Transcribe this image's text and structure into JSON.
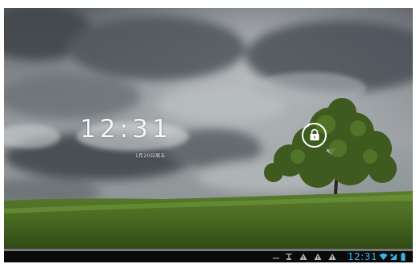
{
  "lockscreen": {
    "time": "12:31",
    "date": "1月20日周五"
  },
  "status_bar": {
    "time": "12:31",
    "icons": [
      "minimize-icon",
      "usb-icon",
      "warning-icon",
      "warning-icon",
      "warning-icon",
      "wifi-icon",
      "signal-icon",
      "battery-icon"
    ]
  },
  "colors": {
    "status_accent": "#33b5e5",
    "status_background": "#0a0a0a"
  }
}
